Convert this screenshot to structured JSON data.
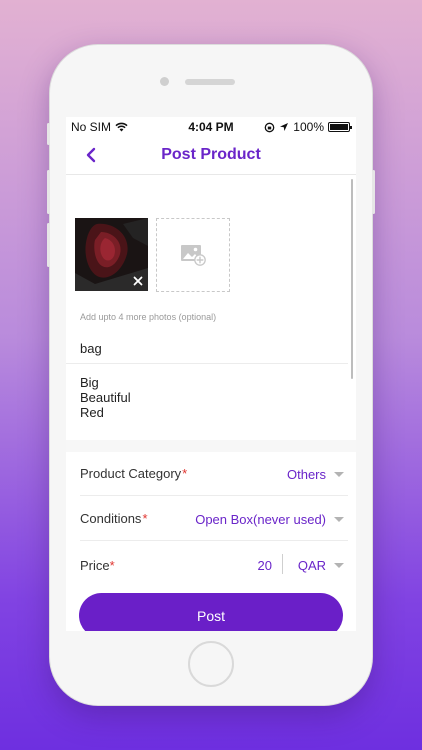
{
  "status_bar": {
    "carrier": "No SIM",
    "time": "4:04 PM",
    "battery_percent": "100%"
  },
  "nav": {
    "title": "Post Product",
    "back_icon": "chevron-left-icon"
  },
  "photos": {
    "hint": "Add upto 4 more photos (optional)",
    "remove_icon": "close-icon",
    "add_icon": "add-photo-icon"
  },
  "product": {
    "title": "bag",
    "description_lines": [
      "Big",
      "Beautiful",
      "Red"
    ]
  },
  "fields": {
    "category": {
      "label": "Product Category",
      "required_mark": "*",
      "value": "Others"
    },
    "condition": {
      "label": "Conditions",
      "required_mark": "*",
      "value": "Open Box(never used)"
    },
    "price": {
      "label": "Price",
      "required_mark": "*",
      "value": "20",
      "currency": "QAR"
    }
  },
  "actions": {
    "post_label": "Post"
  },
  "colors": {
    "accent": "#6a25c9",
    "button": "#6a1fc8",
    "required": "#e0332e"
  }
}
